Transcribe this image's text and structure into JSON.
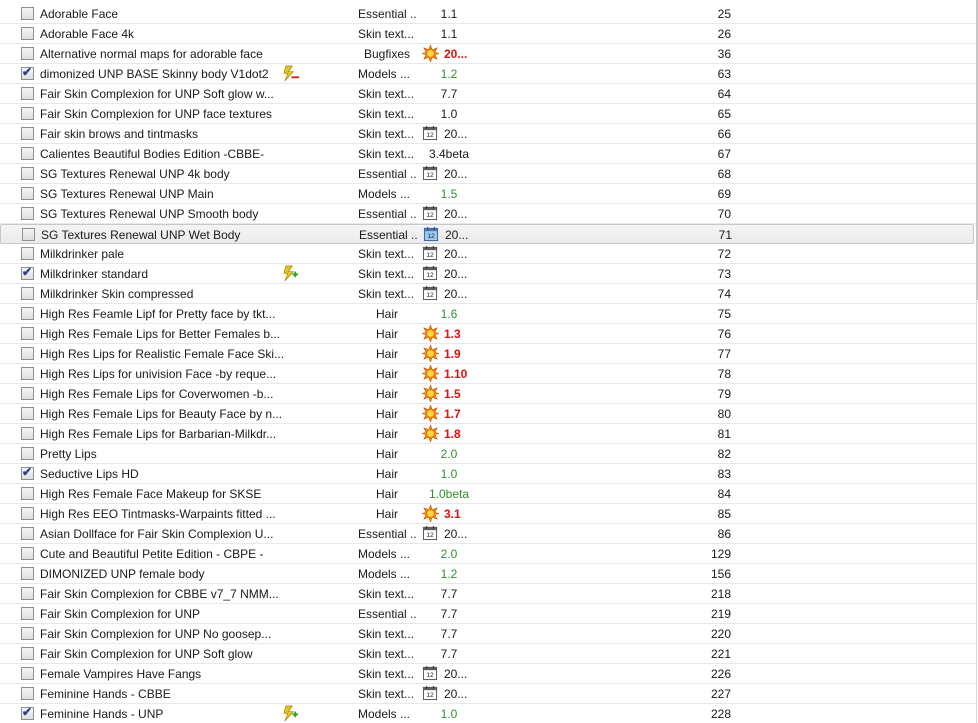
{
  "mods": [
    {
      "name": "Adorable Face",
      "checked": false,
      "flag": "",
      "category": "Essential ...",
      "version": "1.1",
      "version_style": "plain",
      "version_icon": "",
      "priority": "25"
    },
    {
      "name": "Adorable Face 4k",
      "checked": false,
      "flag": "",
      "category": "Skin text...",
      "version": "1.1",
      "version_style": "plain",
      "version_icon": "",
      "priority": "26"
    },
    {
      "name": "Alternative normal maps for adorable face",
      "checked": false,
      "flag": "",
      "category": "Bugfixes",
      "version": "20...",
      "version_style": "red",
      "version_icon": "burst-icon",
      "priority": "36"
    },
    {
      "name": "dimonized UNP BASE Skinny body V1dot2",
      "checked": true,
      "flag": "conflict-flag-icon",
      "category": "Models ...",
      "version": "1.2",
      "version_style": "green",
      "version_icon": "",
      "priority": "63"
    },
    {
      "name": "Fair Skin Complexion for UNP Soft glow w...",
      "checked": false,
      "flag": "",
      "category": "Skin text...",
      "version": "7.7",
      "version_style": "plain",
      "version_icon": "",
      "priority": "64"
    },
    {
      "name": "Fair Skin Complexion for UNP face textures",
      "checked": false,
      "flag": "",
      "category": "Skin text...",
      "version": "1.0",
      "version_style": "plain",
      "version_icon": "",
      "priority": "65"
    },
    {
      "name": "Fair skin brows and tintmasks",
      "checked": false,
      "flag": "",
      "category": "Skin text...",
      "version": "20...",
      "version_style": "plain",
      "version_icon": "calendar-icon",
      "priority": "66"
    },
    {
      "name": "Calientes Beautiful Bodies Edition -CBBE-",
      "checked": false,
      "flag": "",
      "category": "Skin text...",
      "version": "3.4beta",
      "version_style": "plain",
      "version_icon": "",
      "priority": "67"
    },
    {
      "name": "SG Textures Renewal UNP 4k body",
      "checked": false,
      "flag": "",
      "category": "Essential ...",
      "version": "20...",
      "version_style": "plain",
      "version_icon": "calendar-icon",
      "priority": "68"
    },
    {
      "name": "SG Textures Renewal UNP Main",
      "checked": false,
      "flag": "",
      "category": "Models ...",
      "version": "1.5",
      "version_style": "green",
      "version_icon": "",
      "priority": "69"
    },
    {
      "name": "SG Textures Renewal UNP Smooth body",
      "checked": false,
      "flag": "",
      "category": "Essential ...",
      "version": "20...",
      "version_style": "plain",
      "version_icon": "calendar-icon",
      "priority": "70"
    },
    {
      "name": "SG Textures Renewal UNP Wet Body",
      "checked": false,
      "flag": "",
      "category": "Essential ...",
      "version": "20...",
      "version_style": "plain",
      "version_icon": "calendar-blue-icon",
      "priority": "71",
      "selected": true
    },
    {
      "name": "Milkdrinker pale",
      "checked": false,
      "flag": "",
      "category": "Skin text...",
      "version": "20...",
      "version_style": "plain",
      "version_icon": "calendar-icon",
      "priority": "72"
    },
    {
      "name": "Milkdrinker standard",
      "checked": true,
      "flag": "plus-flag-icon",
      "category": "Skin text...",
      "version": "20...",
      "version_style": "plain",
      "version_icon": "calendar-icon",
      "priority": "73"
    },
    {
      "name": "Milkdrinker Skin compressed",
      "checked": false,
      "flag": "",
      "category": "Skin text...",
      "version": "20...",
      "version_style": "plain",
      "version_icon": "calendar-icon",
      "priority": "74"
    },
    {
      "name": "High Res Feamle Lipf for Pretty face by tkt...",
      "checked": false,
      "flag": "",
      "category": "Hair",
      "version": "1.6",
      "version_style": "green",
      "version_icon": "",
      "priority": "75"
    },
    {
      "name": "High Res Female Lips for Better Females b...",
      "checked": false,
      "flag": "",
      "category": "Hair",
      "version": "1.3",
      "version_style": "red",
      "version_icon": "burst-icon",
      "priority": "76"
    },
    {
      "name": "High Res Lips for Realistic Female Face Ski...",
      "checked": false,
      "flag": "",
      "category": "Hair",
      "version": "1.9",
      "version_style": "red",
      "version_icon": "burst-icon",
      "priority": "77"
    },
    {
      "name": "High Res Lips for univision Face -by reque...",
      "checked": false,
      "flag": "",
      "category": "Hair",
      "version": "1.10",
      "version_style": "red",
      "version_icon": "burst-icon",
      "priority": "78"
    },
    {
      "name": "High Res Female Lips for Coverwomen -b...",
      "checked": false,
      "flag": "",
      "category": "Hair",
      "version": "1.5",
      "version_style": "red",
      "version_icon": "burst-icon",
      "priority": "79"
    },
    {
      "name": "High Res Female Lips for Beauty Face by n...",
      "checked": false,
      "flag": "",
      "category": "Hair",
      "version": "1.7",
      "version_style": "red",
      "version_icon": "burst-icon",
      "priority": "80"
    },
    {
      "name": "High Res Female Lips for Barbarian-Milkdr...",
      "checked": false,
      "flag": "",
      "category": "Hair",
      "version": "1.8",
      "version_style": "red",
      "version_icon": "burst-icon",
      "priority": "81"
    },
    {
      "name": "Pretty Lips",
      "checked": false,
      "flag": "",
      "category": "Hair",
      "version": "2.0",
      "version_style": "green",
      "version_icon": "",
      "priority": "82"
    },
    {
      "name": "Seductive Lips HD",
      "checked": true,
      "flag": "",
      "category": "Hair",
      "version": "1.0",
      "version_style": "green",
      "version_icon": "",
      "priority": "83"
    },
    {
      "name": "High Res Female Face Makeup for SKSE",
      "checked": false,
      "flag": "",
      "category": "Hair",
      "version": "1.0beta",
      "version_style": "green",
      "version_icon": "",
      "priority": "84"
    },
    {
      "name": "High Res EEO Tintmasks-Warpaints fitted ...",
      "checked": false,
      "flag": "",
      "category": "Hair",
      "version": "3.1",
      "version_style": "red",
      "version_icon": "burst-icon",
      "priority": "85"
    },
    {
      "name": "Asian Dollface for Fair Skin Complexion U...",
      "checked": false,
      "flag": "",
      "category": "Essential ...",
      "version": "20...",
      "version_style": "plain",
      "version_icon": "calendar-icon",
      "priority": "86"
    },
    {
      "name": "Cute and Beautiful Petite Edition - CBPE -",
      "checked": false,
      "flag": "",
      "category": "Models ...",
      "version": "2.0",
      "version_style": "green",
      "version_icon": "",
      "priority": "129"
    },
    {
      "name": "DIMONIZED UNP female body",
      "checked": false,
      "flag": "",
      "category": "Models ...",
      "version": "1.2",
      "version_style": "green",
      "version_icon": "",
      "priority": "156"
    },
    {
      "name": "Fair Skin Complexion for CBBE v7_7 NMM...",
      "checked": false,
      "flag": "",
      "category": "Skin text...",
      "version": "7.7",
      "version_style": "plain",
      "version_icon": "",
      "priority": "218"
    },
    {
      "name": "Fair Skin Complexion for UNP",
      "checked": false,
      "flag": "",
      "category": "Essential ...",
      "version": "7.7",
      "version_style": "plain",
      "version_icon": "",
      "priority": "219"
    },
    {
      "name": "Fair Skin Complexion for UNP No goosep...",
      "checked": false,
      "flag": "",
      "category": "Skin text...",
      "version": "7.7",
      "version_style": "plain",
      "version_icon": "",
      "priority": "220"
    },
    {
      "name": "Fair Skin Complexion for UNP Soft glow",
      "checked": false,
      "flag": "",
      "category": "Skin text...",
      "version": "7.7",
      "version_style": "plain",
      "version_icon": "",
      "priority": "221"
    },
    {
      "name": "Female Vampires Have Fangs",
      "checked": false,
      "flag": "",
      "category": "Skin text...",
      "version": "20...",
      "version_style": "plain",
      "version_icon": "calendar-icon",
      "priority": "226"
    },
    {
      "name": "Feminine Hands - CBBE",
      "checked": false,
      "flag": "",
      "category": "Skin text...",
      "version": "20...",
      "version_style": "plain",
      "version_icon": "calendar-icon",
      "priority": "227"
    },
    {
      "name": "Feminine Hands - UNP",
      "checked": true,
      "flag": "plus-flag-icon",
      "category": "Models ...",
      "version": "1.0",
      "version_style": "green",
      "version_icon": "",
      "priority": "228"
    }
  ]
}
